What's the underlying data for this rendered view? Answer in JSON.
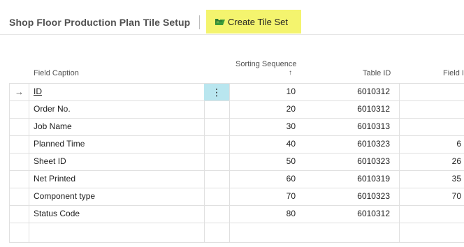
{
  "page": {
    "title": "Shop Floor Production Plan Tile Setup",
    "action_label": "Create Tile Set",
    "action_color": "#f4f46e"
  },
  "columns": {
    "field_caption": "Field Caption",
    "sorting_sequence": "Sorting Sequence",
    "sort_indicator": "↑",
    "table_id": "Table ID",
    "field_id": "Field I"
  },
  "rows": [
    {
      "caption": "ID",
      "seq": "10",
      "table": "6010312",
      "field": ""
    },
    {
      "caption": "Order No.",
      "seq": "20",
      "table": "6010312",
      "field": ""
    },
    {
      "caption": "Job Name",
      "seq": "30",
      "table": "6010313",
      "field": ""
    },
    {
      "caption": "Planned Time",
      "seq": "40",
      "table": "6010323",
      "field": "6"
    },
    {
      "caption": "Sheet ID",
      "seq": "50",
      "table": "6010323",
      "field": "26"
    },
    {
      "caption": "Net Printed",
      "seq": "60",
      "table": "6010319",
      "field": "35"
    },
    {
      "caption": "Component type",
      "seq": "70",
      "table": "6010323",
      "field": "70"
    },
    {
      "caption": "Status Code",
      "seq": "80",
      "table": "6010312",
      "field": ""
    }
  ],
  "row_marker": "→",
  "row_menu": "⋮",
  "selection_color": "#b9e6ef"
}
